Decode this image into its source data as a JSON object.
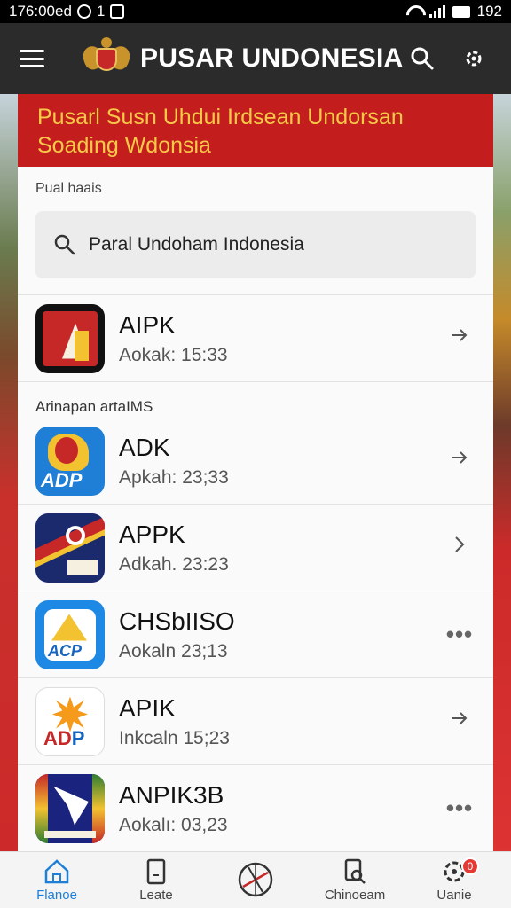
{
  "status_bar": {
    "time": "176:00ed",
    "indicator": "1",
    "clock": "192"
  },
  "app_bar": {
    "title": "PUSAR UNDONESIA"
  },
  "banner": {
    "line1": "Pusarl Susn Uhdui Irdsean Undorsan",
    "line2": "Soading Wdonsia"
  },
  "section_label": "Pual haais",
  "search": {
    "value": "Paral Undoham Indonesia"
  },
  "group_label": "Arinapan artaIMS",
  "items": [
    {
      "title": "AIPK",
      "subtitle": "Aokak: 15:33",
      "trail": "arrow"
    },
    {
      "title": "ADK",
      "subtitle": "Apkah: 23;33",
      "trail": "arrow"
    },
    {
      "title": "APPK",
      "subtitle": "Adkah. 23:23",
      "trail": "arrow"
    },
    {
      "title": "CHSbIISO",
      "subtitle": "Aokaln 23;13",
      "trail": "more"
    },
    {
      "title": "APIK",
      "subtitle": "Inkcaln 15;23",
      "trail": "arrow"
    },
    {
      "title": "ANPIK3B",
      "subtitle": "Aokalı: 03,23",
      "trail": "more"
    }
  ],
  "icon_text": {
    "adp": "ADP",
    "acp": "ACP",
    "ad": "AD",
    "p": "P"
  },
  "bottom_nav": [
    {
      "label": "Flanoe",
      "icon": "home-icon"
    },
    {
      "label": "Leate",
      "icon": "tablet-icon"
    },
    {
      "label": "",
      "icon": "compass-icon"
    },
    {
      "label": "Chinoeam",
      "icon": "document-search-icon"
    },
    {
      "label": "Uanie",
      "icon": "gear-icon",
      "badge": "0"
    }
  ],
  "colors": {
    "accent": "#1e7fd6",
    "banner": "#c41d1d",
    "banner_text": "#f7c948",
    "app_bar": "#2b2b2b"
  }
}
